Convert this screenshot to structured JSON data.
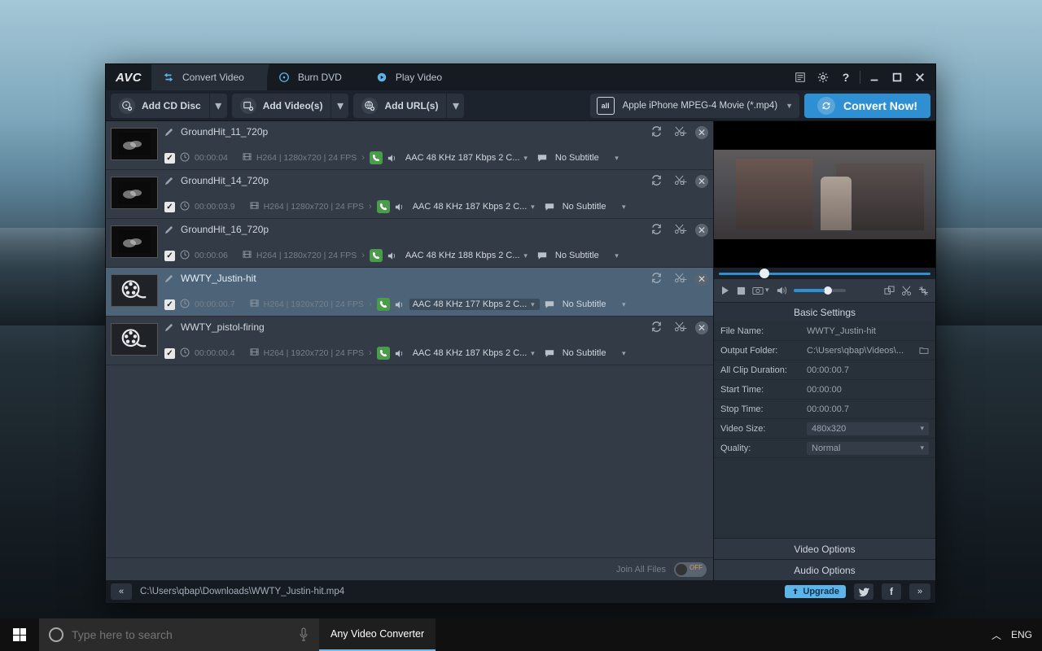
{
  "app": {
    "logo": "AVC"
  },
  "title_tabs": [
    {
      "label": "Convert Video",
      "active": true
    },
    {
      "label": "Burn DVD",
      "active": false
    },
    {
      "label": "Play Video",
      "active": false
    }
  ],
  "toolbar": {
    "add_cd": "Add CD Disc",
    "add_videos": "Add Video(s)",
    "add_urls": "Add URL(s)",
    "format_badge": "all",
    "format_label": "Apple iPhone MPEG-4 Movie (*.mp4)",
    "convert": "Convert Now!"
  },
  "items": [
    {
      "title": "GroundHit_11_720p",
      "dur": "00:00:04",
      "meta": "H264 | 1280x720 | 24 FPS",
      "audio": "AAC 48 KHz 187 Kbps 2 C...",
      "sub": "No Subtitle",
      "thumb": "smoke"
    },
    {
      "title": "GroundHit_14_720p",
      "dur": "00:00:03.9",
      "meta": "H264 | 1280x720 | 24 FPS",
      "audio": "AAC 48 KHz 187 Kbps 2 C...",
      "sub": "No Subtitle",
      "thumb": "smoke"
    },
    {
      "title": "GroundHit_16_720p",
      "dur": "00:00:06",
      "meta": "H264 | 1280x720 | 24 FPS",
      "audio": "AAC 48 KHz 188 Kbps 2 C...",
      "sub": "No Subtitle",
      "thumb": "smoke"
    },
    {
      "title": "WWTY_Justin-hit",
      "dur": "00:00:00.7",
      "meta": "H264 | 1920x720 | 24 FPS",
      "audio": "AAC 48 KHz 177 Kbps 2 C...",
      "sub": "No Subtitle",
      "thumb": "reel",
      "selected": true
    },
    {
      "title": "WWTY_pistol-firing",
      "dur": "00:00:00.4",
      "meta": "H264 | 1920x720 | 24 FPS",
      "audio": "AAC 48 KHz 187 Kbps 2 C...",
      "sub": "No Subtitle",
      "thumb": "reel"
    }
  ],
  "join_label": "Join All Files",
  "settings": {
    "header": "Basic Settings",
    "file_name_label": "File Name:",
    "file_name": "WWTY_Justin-hit",
    "output_folder_label": "Output Folder:",
    "output_folder": "C:\\Users\\qbap\\Videos\\...",
    "clip_dur_label": "All Clip Duration:",
    "clip_dur": "00:00:00.7",
    "start_label": "Start Time:",
    "start": "00:00:00",
    "stop_label": "Stop Time:",
    "stop": "00:00:00.7",
    "size_label": "Video Size:",
    "size": "480x320",
    "quality_label": "Quality:",
    "quality": "Normal",
    "video_opts": "Video Options",
    "audio_opts": "Audio Options"
  },
  "statusbar": {
    "path": "C:\\Users\\qbap\\Downloads\\WWTY_Justin-hit.mp4",
    "upgrade": "Upgrade"
  },
  "taskbar": {
    "search_placeholder": "Type here to search",
    "app_name": "Any Video Converter",
    "lang": "ENG"
  }
}
